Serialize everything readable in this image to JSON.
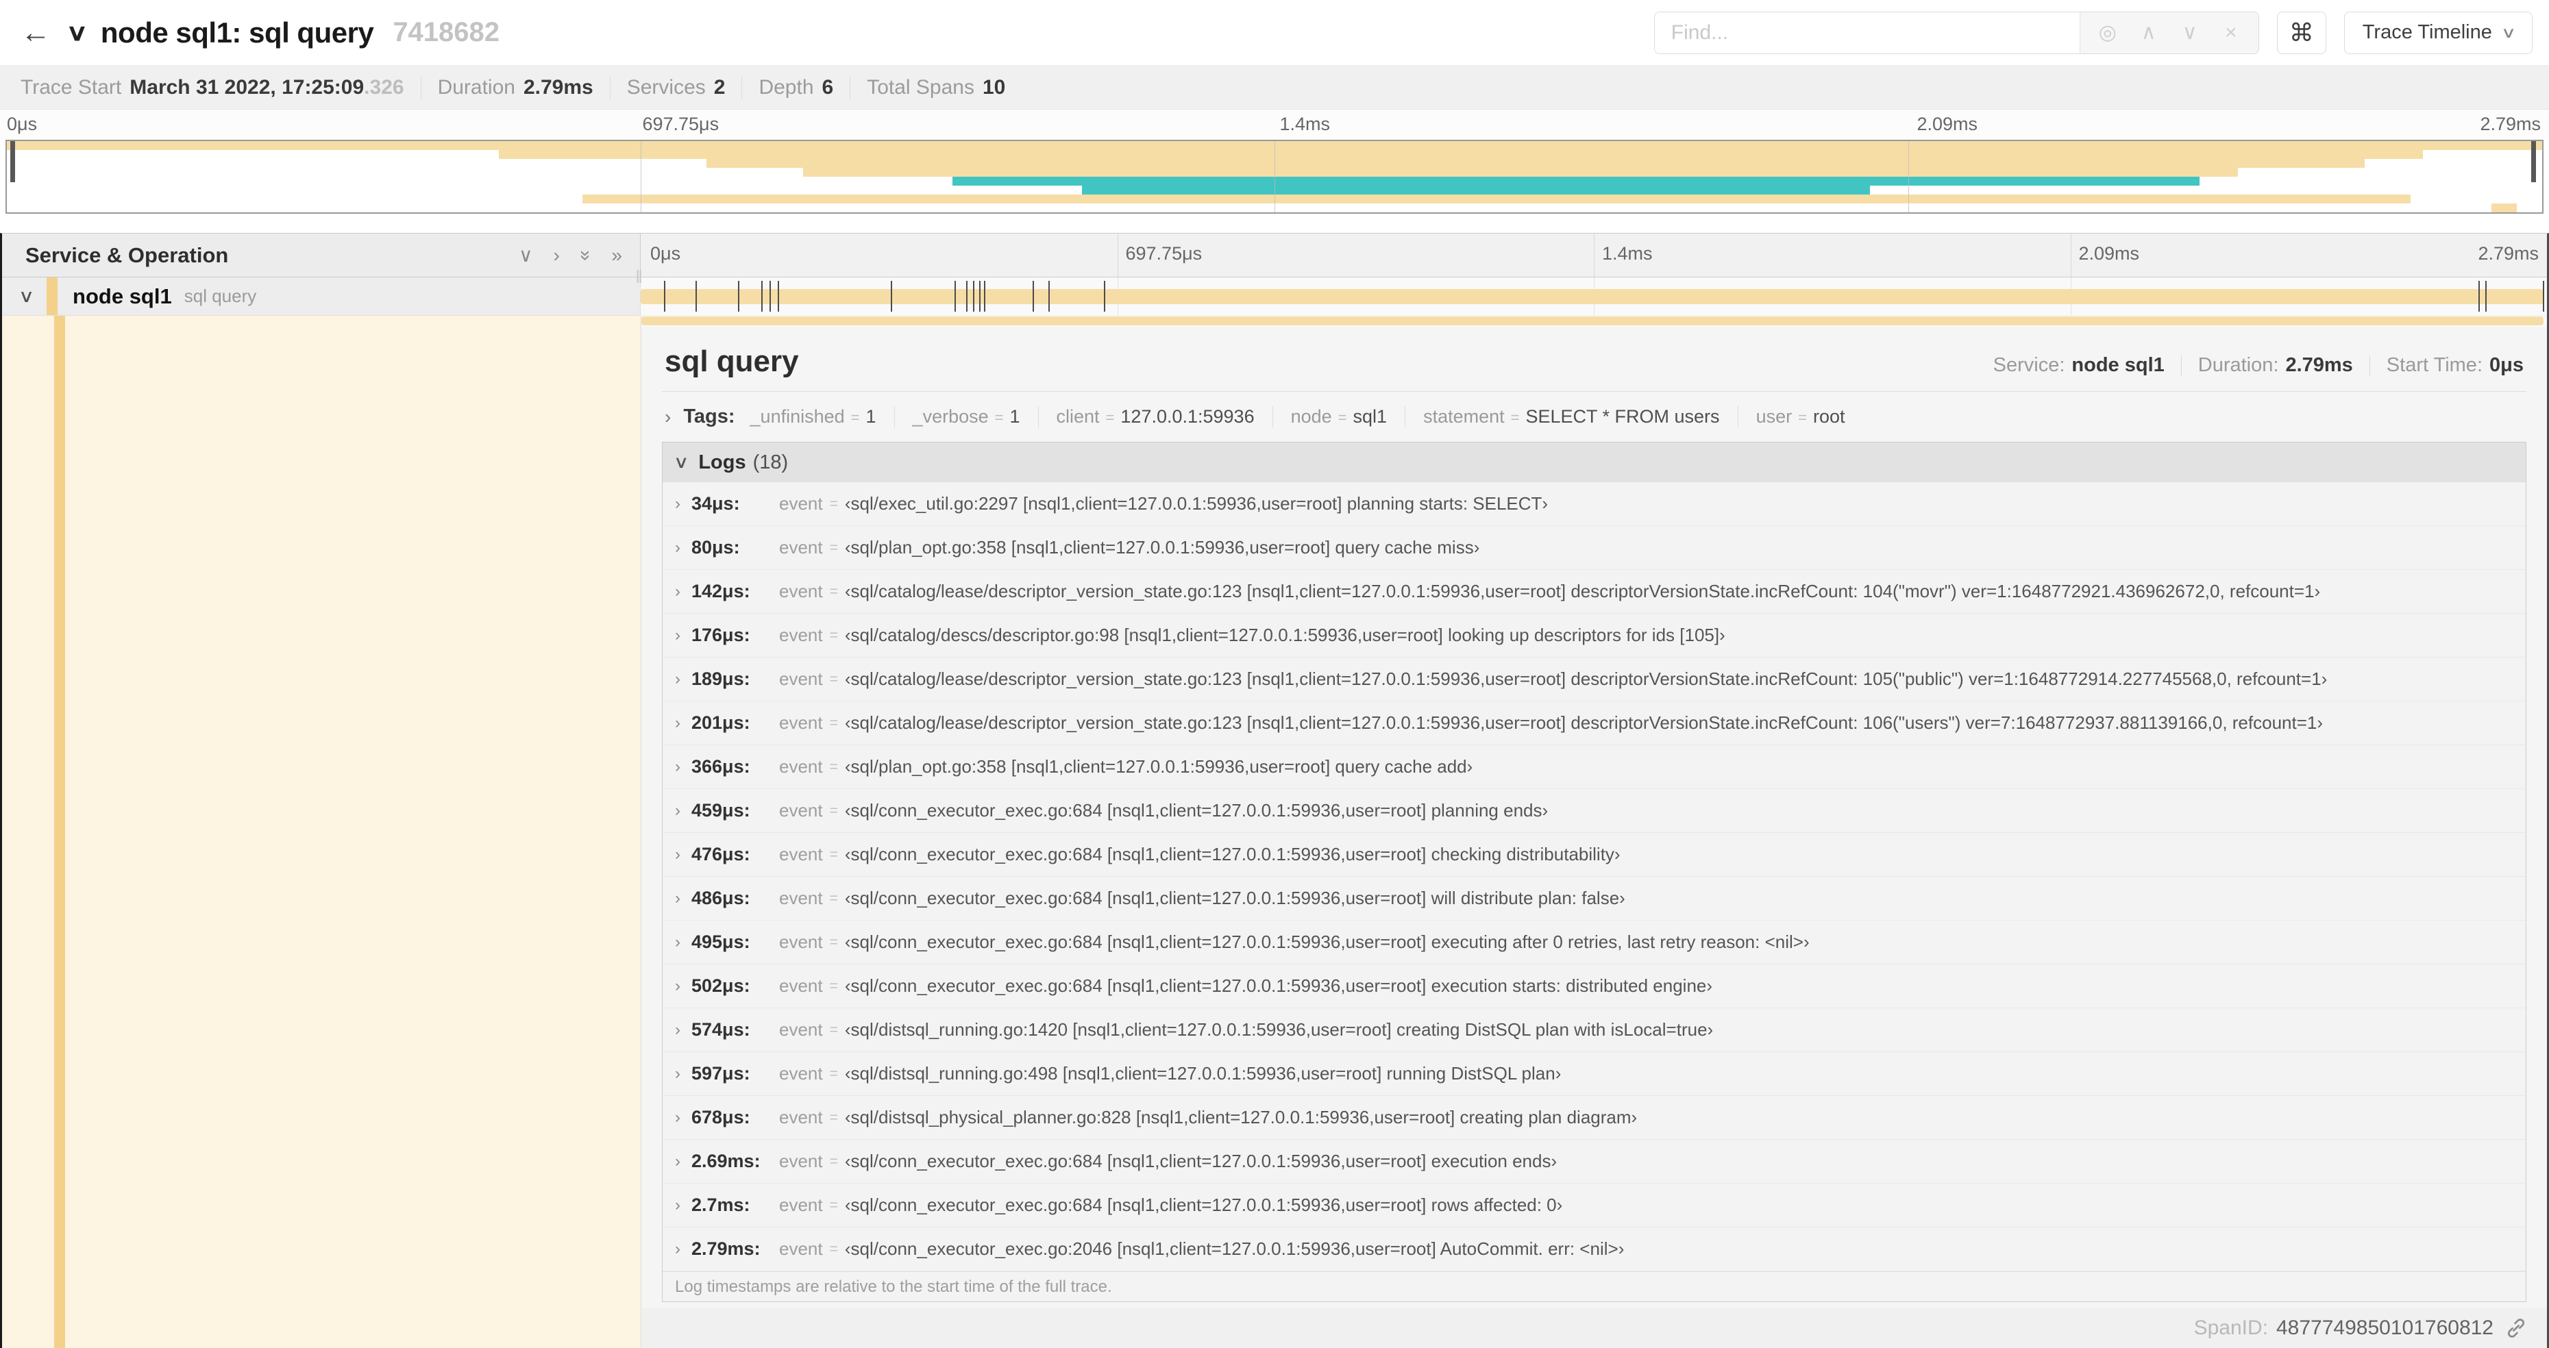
{
  "header": {
    "back_arrow": "←",
    "title": "node sql1: sql query",
    "trace_id": "7418682",
    "find_placeholder": "Find...",
    "shortcut_key": "⌘",
    "view_select": "Trace Timeline"
  },
  "infobar": {
    "trace_start_label": "Trace Start",
    "trace_start_value": "March 31 2022, 17:25:09",
    "trace_start_fraction": ".326",
    "duration_label": "Duration",
    "duration_value": "2.79ms",
    "services_label": "Services",
    "services_value": "2",
    "depth_label": "Depth",
    "depth_value": "6",
    "total_spans_label": "Total Spans",
    "total_spans_value": "10"
  },
  "timeline": {
    "tick_labels": [
      "0μs",
      "697.75μs",
      "1.4ms",
      "2.09ms",
      "2.79ms"
    ],
    "colors": {
      "tan": "#f6dda6",
      "teal": "#41c5c2"
    },
    "minimap_bars": [
      {
        "start": 0,
        "end": 100,
        "color": "tan"
      },
      {
        "start": 19.4,
        "end": 95.3,
        "color": "tan"
      },
      {
        "start": 27.6,
        "end": 93.0,
        "color": "tan"
      },
      {
        "start": 31.4,
        "end": 88.0,
        "color": "tan"
      },
      {
        "start": 37.3,
        "end": 86.5,
        "color": "teal"
      },
      {
        "start": 42.4,
        "end": 73.5,
        "color": "teal"
      },
      {
        "start": 22.7,
        "end": 94.8,
        "color": "tan"
      },
      {
        "start": 98.0,
        "end": 99.0,
        "color": "tan"
      }
    ],
    "log_tick_pct": [
      1.22,
      2.87,
      5.09,
      6.31,
      6.77,
      7.2,
      13.12,
      16.45,
      17.06,
      17.42,
      17.74,
      18.0,
      20.57,
      21.4,
      24.3,
      96.42,
      96.77,
      99.8
    ]
  },
  "left_panel": {
    "header": "Service & Operation",
    "span_service": "node sql1",
    "span_operation": "sql query"
  },
  "detail": {
    "title": "sql query",
    "service_label": "Service:",
    "service_value": "node sql1",
    "duration_label": "Duration:",
    "duration_value": "2.79ms",
    "start_time_label": "Start Time:",
    "start_time_value": "0μs",
    "tags_label": "Tags:",
    "tags": [
      {
        "key": "_unfinished",
        "value": "1"
      },
      {
        "key": "_verbose",
        "value": "1"
      },
      {
        "key": "client",
        "value": "127.0.0.1:59936"
      },
      {
        "key": "node",
        "value": "sql1"
      },
      {
        "key": "statement",
        "value": "SELECT * FROM users"
      },
      {
        "key": "user",
        "value": "root"
      }
    ],
    "logs_label": "Logs",
    "logs_count": "(18)",
    "logs": [
      {
        "time": "34μs:",
        "field": "event",
        "value": "‹sql/exec_util.go:2297 [nsql1,client=127.0.0.1:59936,user=root] planning starts: SELECT›"
      },
      {
        "time": "80μs:",
        "field": "event",
        "value": "‹sql/plan_opt.go:358 [nsql1,client=127.0.0.1:59936,user=root] query cache miss›"
      },
      {
        "time": "142μs:",
        "field": "event",
        "value": "‹sql/catalog/lease/descriptor_version_state.go:123 [nsql1,client=127.0.0.1:59936,user=root] descriptorVersionState.incRefCount: 104(\"movr\") ver=1:1648772921.436962672,0, refcount=1›"
      },
      {
        "time": "176μs:",
        "field": "event",
        "value": "‹sql/catalog/descs/descriptor.go:98 [nsql1,client=127.0.0.1:59936,user=root] looking up descriptors for ids [105]›"
      },
      {
        "time": "189μs:",
        "field": "event",
        "value": "‹sql/catalog/lease/descriptor_version_state.go:123 [nsql1,client=127.0.0.1:59936,user=root] descriptorVersionState.incRefCount: 105(\"public\") ver=1:1648772914.227745568,0, refcount=1›"
      },
      {
        "time": "201μs:",
        "field": "event",
        "value": "‹sql/catalog/lease/descriptor_version_state.go:123 [nsql1,client=127.0.0.1:59936,user=root] descriptorVersionState.incRefCount: 106(\"users\") ver=7:1648772937.881139166,0, refcount=1›"
      },
      {
        "time": "366μs:",
        "field": "event",
        "value": "‹sql/plan_opt.go:358 [nsql1,client=127.0.0.1:59936,user=root] query cache add›"
      },
      {
        "time": "459μs:",
        "field": "event",
        "value": "‹sql/conn_executor_exec.go:684 [nsql1,client=127.0.0.1:59936,user=root] planning ends›"
      },
      {
        "time": "476μs:",
        "field": "event",
        "value": "‹sql/conn_executor_exec.go:684 [nsql1,client=127.0.0.1:59936,user=root] checking distributability›"
      },
      {
        "time": "486μs:",
        "field": "event",
        "value": "‹sql/conn_executor_exec.go:684 [nsql1,client=127.0.0.1:59936,user=root] will distribute plan: false›"
      },
      {
        "time": "495μs:",
        "field": "event",
        "value": "‹sql/conn_executor_exec.go:684 [nsql1,client=127.0.0.1:59936,user=root] executing after 0 retries, last retry reason: <nil>›"
      },
      {
        "time": "502μs:",
        "field": "event",
        "value": "‹sql/conn_executor_exec.go:684 [nsql1,client=127.0.0.1:59936,user=root] execution starts: distributed engine›"
      },
      {
        "time": "574μs:",
        "field": "event",
        "value": "‹sql/distsql_running.go:1420 [nsql1,client=127.0.0.1:59936,user=root] creating DistSQL plan with isLocal=true›"
      },
      {
        "time": "597μs:",
        "field": "event",
        "value": "‹sql/distsql_running.go:498 [nsql1,client=127.0.0.1:59936,user=root] running DistSQL plan›"
      },
      {
        "time": "678μs:",
        "field": "event",
        "value": "‹sql/distsql_physical_planner.go:828 [nsql1,client=127.0.0.1:59936,user=root] creating plan diagram›"
      },
      {
        "time": "2.69ms:",
        "field": "event",
        "value": "‹sql/conn_executor_exec.go:684 [nsql1,client=127.0.0.1:59936,user=root] execution ends›"
      },
      {
        "time": "2.7ms:",
        "field": "event",
        "value": "‹sql/conn_executor_exec.go:684 [nsql1,client=127.0.0.1:59936,user=root] rows affected: 0›"
      },
      {
        "time": "2.79ms:",
        "field": "event",
        "value": "‹sql/conn_executor_exec.go:2046 [nsql1,client=127.0.0.1:59936,user=root] AutoCommit. err: <nil>›"
      }
    ],
    "logs_note": "Log timestamps are relative to the start time of the full trace.",
    "spanid_label": "SpanID:",
    "spanid_value": "4877749850101760812"
  }
}
